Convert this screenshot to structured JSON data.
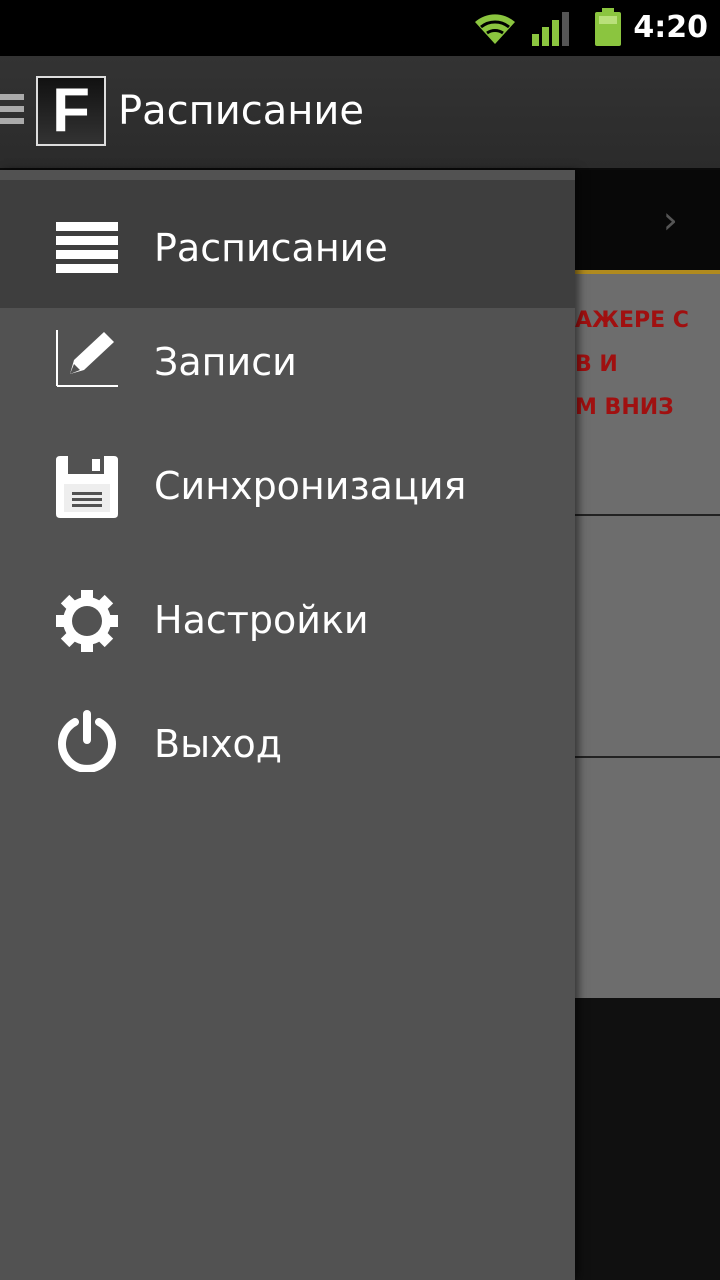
{
  "status_bar": {
    "time": "4:20",
    "icons": [
      "wifi-icon",
      "signal-icon",
      "battery-icon"
    ],
    "accent_color": "#8bc53f"
  },
  "action_bar": {
    "logo_letter": "F",
    "title": "Расписание"
  },
  "background_content": {
    "next_arrow": "›",
    "card_lines": [
      "АЖЕРЕ С",
      "В И",
      "М ВНИЗ"
    ],
    "accent_color": "#b08a1e",
    "text_color": "#a01010"
  },
  "drawer": {
    "items": [
      {
        "label": "Расписание",
        "icon": "list-icon",
        "active": true
      },
      {
        "label": "Записи",
        "icon": "pencil-icon",
        "active": false
      },
      {
        "label": "Синхронизация",
        "icon": "floppy-disk-icon",
        "active": false
      },
      {
        "label": "Настройки",
        "icon": "gear-icon",
        "active": false
      },
      {
        "label": "Выход",
        "icon": "power-icon",
        "active": false
      }
    ]
  }
}
